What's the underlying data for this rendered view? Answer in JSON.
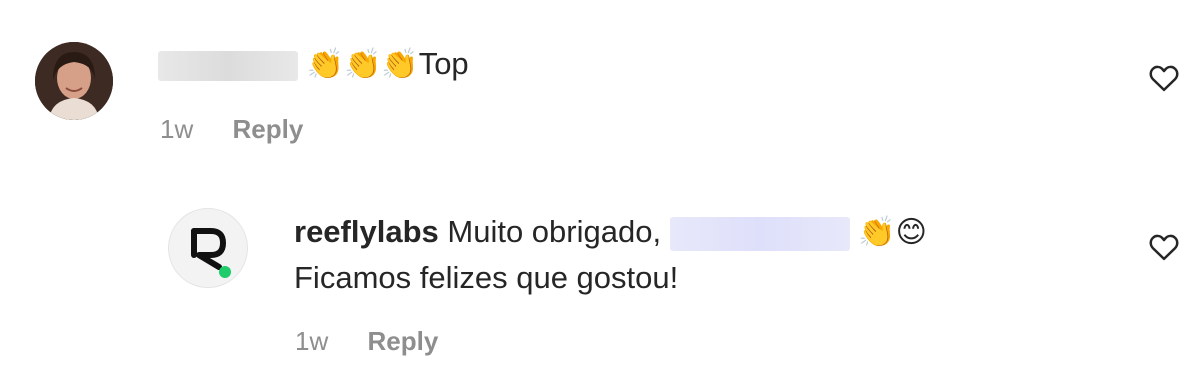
{
  "comments": [
    {
      "text": "Top",
      "emojis": "👏👏👏",
      "time": "1w",
      "reply_label": "Reply"
    },
    {
      "username": "reeflylabs",
      "text_line1": "Muito obrigado,",
      "emojis": "👏😊",
      "text_line2": "Ficamos felizes que gostou!",
      "time": "1w",
      "reply_label": "Reply"
    }
  ],
  "icons": {
    "like": "heart-outline-icon",
    "brand_logo": "reeflylabs-r-logo",
    "brand_dot_color": "#1fcb6a"
  }
}
